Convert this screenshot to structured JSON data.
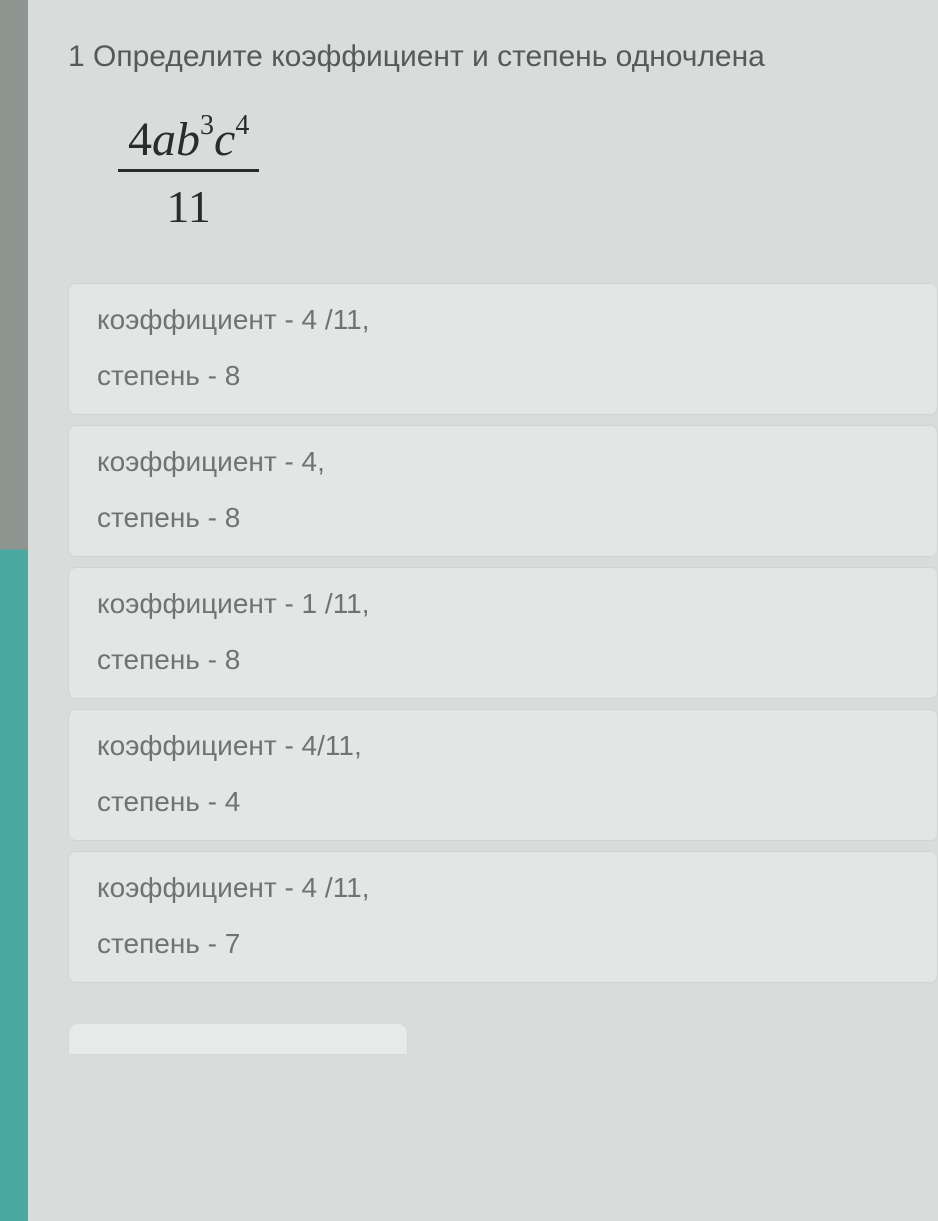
{
  "question": {
    "title": "1 Определите коэффициент и степень одночлена",
    "formula": {
      "numerator_coef": "4",
      "numerator_var1": "a",
      "numerator_var2": "b",
      "numerator_exp2": "3",
      "numerator_var3": "c",
      "numerator_exp3": "4",
      "denominator": "11"
    }
  },
  "options": [
    {
      "line1": "коэффициент - 4 /11,",
      "line2": "степень - 8"
    },
    {
      "line1": "коэффициент - 4,",
      "line2": "степень - 8"
    },
    {
      "line1": "коэффициент - 1 /11,",
      "line2": "степень - 8"
    },
    {
      "line1": "коэффициент - 4/11,",
      "line2": "степень - 4"
    },
    {
      "line1": "коэффициент - 4 /11,",
      "line2": "степень - 7"
    }
  ]
}
